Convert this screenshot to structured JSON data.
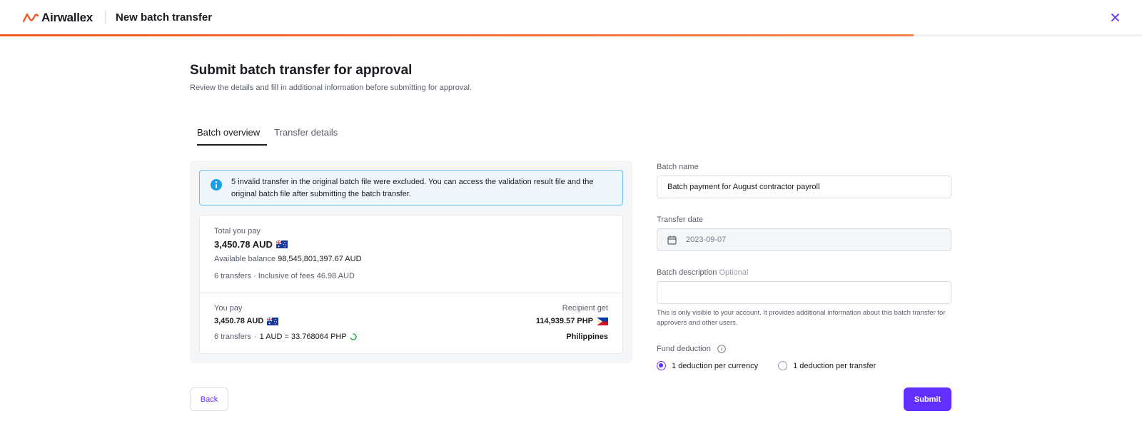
{
  "header": {
    "brand": "Airwallex",
    "title": "New batch transfer",
    "close_icon": "close-icon",
    "progress": 0.8
  },
  "page": {
    "title": "Submit batch transfer for approval",
    "subtitle": "Review the details and fill in additional information before submitting for approval."
  },
  "tabs": [
    {
      "label": "Batch overview",
      "active": true
    },
    {
      "label": "Transfer details",
      "active": false
    }
  ],
  "alert": {
    "icon": "info-icon",
    "text": "5 invalid transfer in the original batch file were excluded. You can access the validation result file and the original batch file after submitting the batch transfer."
  },
  "summary": {
    "total_label": "Total you pay",
    "total_amount": "3,450.78 AUD",
    "available_label": "Available balance",
    "available_value": "98,545,801,397.67 AUD",
    "transfers": "6 transfers",
    "fees": "Inclusive of fees 46.98 AUD",
    "you_pay_label": "You pay",
    "you_pay_amount": "3,450.78 AUD",
    "rate_transfers": "6 transfers",
    "rate": "1 AUD = 33.768064 PHP",
    "recipient_label": "Recipient get",
    "recipient_amount": "114,939.57 PHP",
    "recipient_country": "Philippines"
  },
  "form": {
    "batch_name_label": "Batch name",
    "batch_name_value": "Batch payment for August contractor payroll",
    "transfer_date_label": "Transfer date",
    "transfer_date_value": "2023-09-07",
    "description_label": "Batch description",
    "description_optional": "Optional",
    "description_value": "",
    "helper": "This is only visible to your account. It provides additional information about this batch transfer for approvers and other users.",
    "fund_deduction_label": "Fund deduction",
    "options": [
      {
        "label": "1 deduction per currency",
        "checked": true
      },
      {
        "label": "1 deduction per transfer",
        "checked": false
      }
    ]
  },
  "actions": {
    "back": "Back",
    "submit": "Submit"
  },
  "colors": {
    "brand_orange": "#f05a24",
    "accent_purple": "#612fff",
    "info_blue": "#1a9fe8"
  }
}
